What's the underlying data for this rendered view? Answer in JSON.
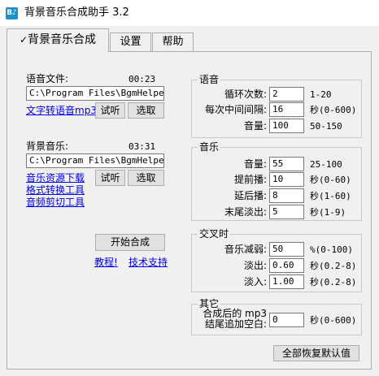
{
  "window": {
    "title": "背景音乐合成助手 3.2",
    "icon": "music-note-icon"
  },
  "tabs": [
    {
      "label": "背景音乐合成",
      "check": "✓"
    },
    {
      "label": "设置"
    },
    {
      "label": "帮助"
    }
  ],
  "voice_file": {
    "label": "语音文件:",
    "duration": "00:23",
    "path": "C:\\Program Files\\BgmHelper\\",
    "tts_link": "文字转语音mp3",
    "preview_button": "试听",
    "select_button": "选取"
  },
  "bgm_file": {
    "label": "背景音乐:",
    "duration": "03:31",
    "path": "C:\\Program Files\\BgmHelper\\",
    "links": [
      "音乐资源下载",
      "格式转换工具",
      "音频剪切工具"
    ],
    "preview_button": "试听",
    "select_button": "选取"
  },
  "actions": {
    "start_button": "开始合成",
    "tutorial_link": "教程!",
    "support_link": "技术支持",
    "reset_button": "全部恢复默认值"
  },
  "voice_group": {
    "title": "语音",
    "loop_label": "循环次数:",
    "loop_value": "2",
    "loop_range": "1-20",
    "interval_label": "每次中间间隔:",
    "interval_value": "16",
    "interval_range": "秒(0-600)",
    "volume_label": "音量:",
    "volume_value": "100",
    "volume_range": "50-150"
  },
  "music_group": {
    "title": "音乐",
    "volume_label": "音量:",
    "volume_value": "55",
    "volume_range": "25-100",
    "pre_label": "提前播:",
    "pre_value": "10",
    "pre_range": "秒(0-60)",
    "delay_label": "延后播:",
    "delay_value": "8",
    "delay_range": "秒(1-60)",
    "fade_label": "末尾淡出:",
    "fade_value": "5",
    "fade_range": "秒(1-9)"
  },
  "cross_group": {
    "title": "交叉时",
    "duck_label": "音乐减弱:",
    "duck_value": "50",
    "duck_range": "%(0-100)",
    "fadeout_label": "淡出:",
    "fadeout_value": "0.60",
    "fadeout_range": "秒(0.2-8)",
    "fadein_label": "淡入:",
    "fadein_value": "1.00",
    "fadein_range": "秒(0.2-8)"
  },
  "other_group": {
    "title": "其它",
    "label_line1": "合成后的 mp3",
    "label_line2": "结尾追加空白:",
    "value": "0",
    "range": "秒(0-600)"
  }
}
